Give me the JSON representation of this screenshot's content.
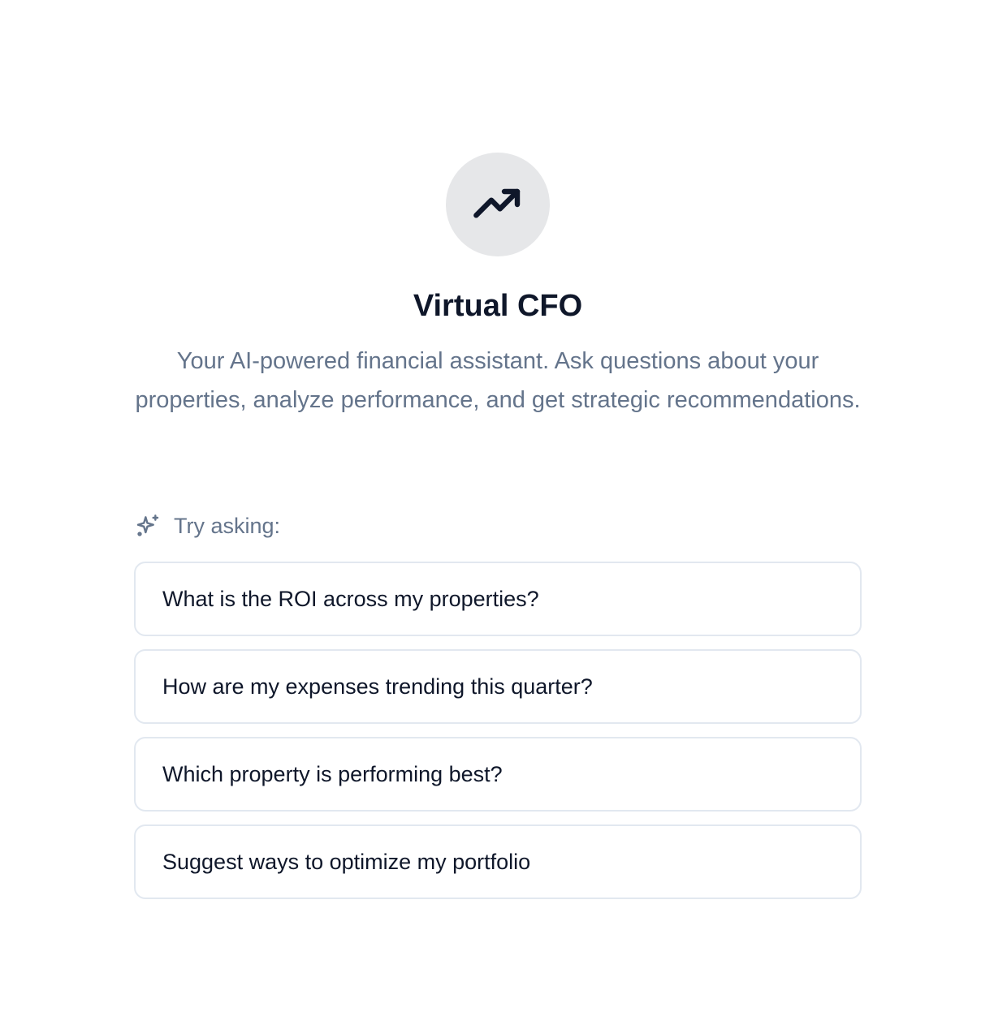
{
  "hero": {
    "icon": "trending-up-icon",
    "title": "Virtual CFO",
    "subtitle": "Your AI-powered financial assistant. Ask questions about your properties, analyze performance, and get strategic recommendations."
  },
  "suggestions_section": {
    "icon": "sparkles-icon",
    "label": "Try asking:",
    "items": [
      {
        "label": "What is the ROI across my properties?"
      },
      {
        "label": "How are my expenses trending this quarter?"
      },
      {
        "label": "Which property is performing best?"
      },
      {
        "label": "Suggest ways to optimize my portfolio"
      }
    ]
  },
  "colors": {
    "icon_circle_bg": "#e6e7e9",
    "title": "#0f172a",
    "muted_text": "#64748b",
    "card_border": "#e2e8f0"
  }
}
